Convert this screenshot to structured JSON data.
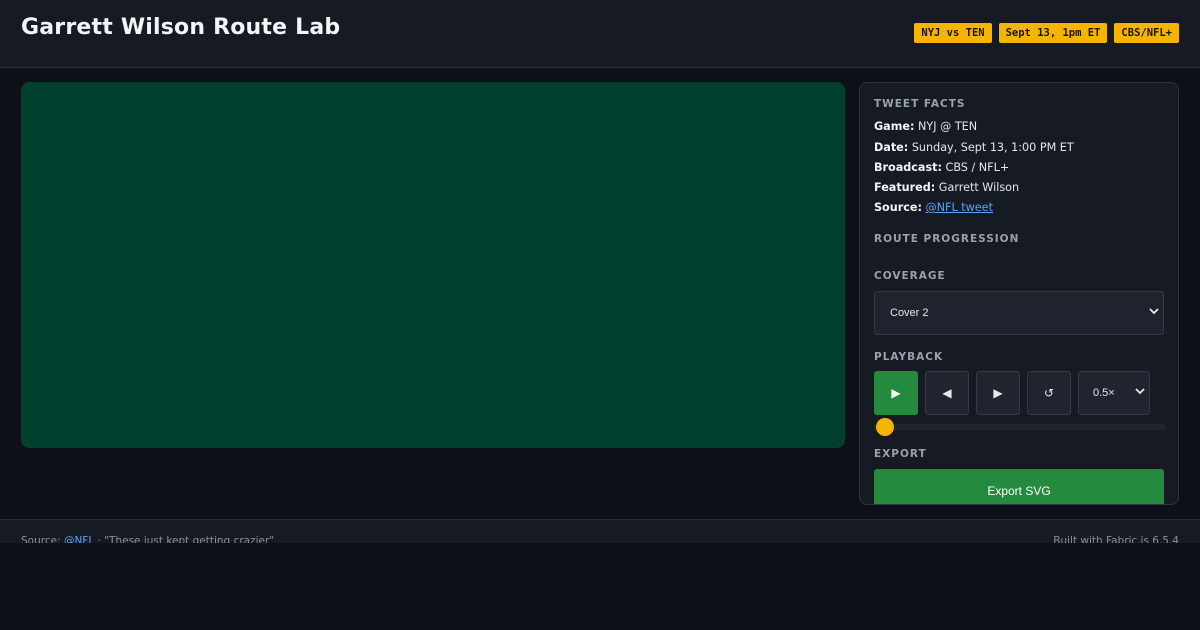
{
  "header": {
    "title": "Garrett Wilson Route Lab",
    "badges": [
      "NYJ vs TEN",
      "Sept 13, 1pm ET",
      "CBS/NFL+"
    ]
  },
  "panel": {
    "tweet_facts": {
      "label": "TWEET FACTS",
      "game_key": "Game:",
      "game_val": "NYJ @ TEN",
      "date_key": "Date:",
      "date_val": "Sunday, Sept 13, 1:00 PM ET",
      "broadcast_key": "Broadcast:",
      "broadcast_val": "CBS / NFL+",
      "featured_key": "Featured:",
      "featured_val": "Garrett Wilson",
      "source_key": "Source:",
      "source_link": "@NFL tweet"
    },
    "route_progression": {
      "label": "ROUTE PROGRESSION"
    },
    "coverage": {
      "label": "COVERAGE",
      "selected": "Cover 2"
    },
    "playback": {
      "label": "PLAYBACK",
      "play_icon": "▶",
      "back_icon": "◀",
      "forward_icon": "▶",
      "reset_icon": "↺",
      "speed": "0.5×",
      "progress": 0
    },
    "export": {
      "label": "EXPORT",
      "button": "Export SVG"
    }
  },
  "footer": {
    "source_prefix": "Source:",
    "source_link": "@NFL",
    "source_quote": "· \"These just kept getting crazier\"",
    "built_with": "Built with Fabric.js 6.5.4"
  },
  "colors": {
    "accent": "#f5b400",
    "field": "#013f2e",
    "button_green": "#248a3d",
    "link": "#5aa2ff"
  },
  "icons": {
    "play": "play-icon",
    "back": "step-back-icon",
    "forward": "step-forward-icon",
    "reset": "reset-icon",
    "chevron": "chevron-down-icon"
  }
}
